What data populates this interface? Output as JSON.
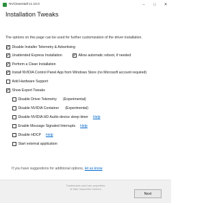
{
  "window": {
    "title": "NVCleanstall v1.10.0",
    "icon": "nvcleanstall-app-icon",
    "controls": [
      "minimize",
      "maximize",
      "close"
    ]
  },
  "page": {
    "title": "Installation Tweaks",
    "intro": "The options on this page can be used for further customization of the driver installation."
  },
  "options": [
    {
      "label": "Disable Installer Telemetry & Advertising",
      "checked": true
    },
    {
      "label": "Unattended Express Installation",
      "checked": true
    },
    {
      "label": "Allow automatic reboot, if needed",
      "checked": true
    },
    {
      "label": "Perform a Clean Installation",
      "checked": true
    },
    {
      "label": "Install NVIDIA Control Panel App from Windows Store (no Microsoft account required)",
      "checked": true
    },
    {
      "label": "Add Hardware Support",
      "checked": false
    },
    {
      "label": "Show Expert Tweaks",
      "checked": true
    }
  ],
  "expert": [
    {
      "label": "Disable Driver Telemetry",
      "note": "(Experimental)",
      "help": "",
      "checked": false
    },
    {
      "label": "Disable NVIDIA Container",
      "note": "(Experimental)",
      "help": "",
      "checked": false
    },
    {
      "label": "Disable NVIDIA HD Audio device sleep timer",
      "note": "",
      "help": "Help",
      "checked": false
    },
    {
      "label": "Enable Message Signaled Interrupts",
      "note": "",
      "help": "Help",
      "checked": false
    },
    {
      "label": "Disable HDCP",
      "note": "",
      "help": "Help",
      "checked": false
    },
    {
      "label": "Start external application",
      "note": "",
      "help": "",
      "checked": false
    }
  ],
  "footer": {
    "suggestion_text": "If you have suggestions for additional options,",
    "suggestion_link": "let us know",
    "trademark_line1": "Trademarks used are properties",
    "trademark_line2": "of their respective owners",
    "next_label": "Next"
  }
}
